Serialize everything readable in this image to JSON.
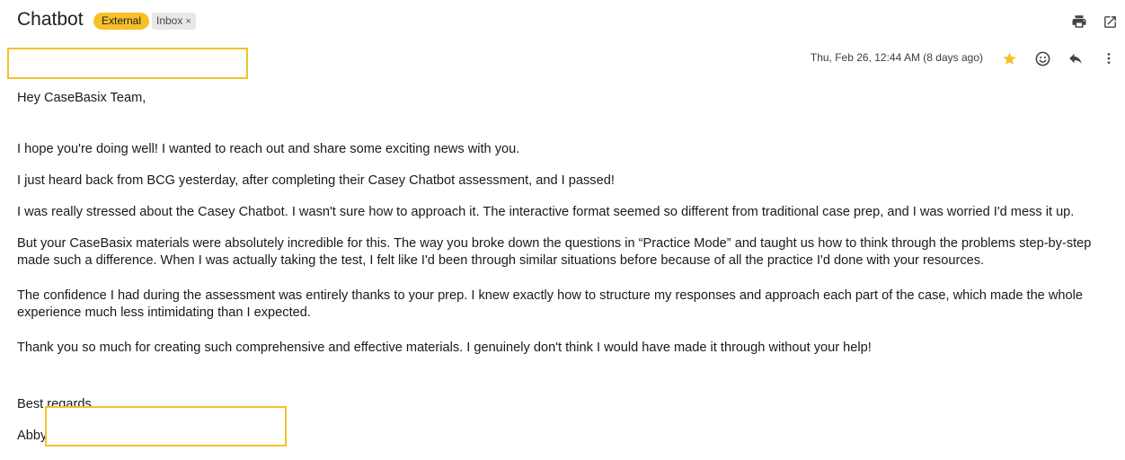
{
  "email": {
    "subject": "Chatbot",
    "labels": {
      "external": "External",
      "inbox": "Inbox",
      "inbox_remove": "×"
    },
    "date": "Thu, Feb 26, 12:44 AM (8 days ago)",
    "greeting": "Hey CaseBasix Team,",
    "paragraphs": [
      "I hope you're doing well! I wanted to reach out and share some exciting news with you.",
      "I just heard back from BCG yesterday, after completing their Casey Chatbot assessment, and I passed!",
      "I was really stressed about the Casey Chatbot. I wasn't sure how to approach it. The interactive format seemed so different from traditional case prep, and I was worried I'd mess it up.",
      "But your CaseBasix materials were absolutely incredible for this. The way you broke down the questions in “Practice Mode” and taught us how to think through the problems step-by-step made such a difference. When I was actually taking the test, I felt like I'd been through similar situations before because of all the practice I'd done with your resources.",
      "The confidence I had during the assessment was entirely thanks to your prep. I knew exactly how to structure my responses and approach each part of the case, which made the whole experience much less intimidating than I expected.",
      "Thank you so much for creating such comprehensive and effective materials. I genuinely don't think I would have made it through without your help!"
    ],
    "signoff": "Best regards,",
    "signature": "Abby"
  },
  "icons": {
    "print": "print-icon",
    "open_new_window": "open-in-new-window-icon",
    "star": "star-icon",
    "emoji": "emoji-icon",
    "reply": "reply-icon",
    "more": "more-vert-icon"
  },
  "colors": {
    "external_badge": "#f6c026",
    "star": "#f6c026",
    "redaction_border": "#f2c32a"
  }
}
